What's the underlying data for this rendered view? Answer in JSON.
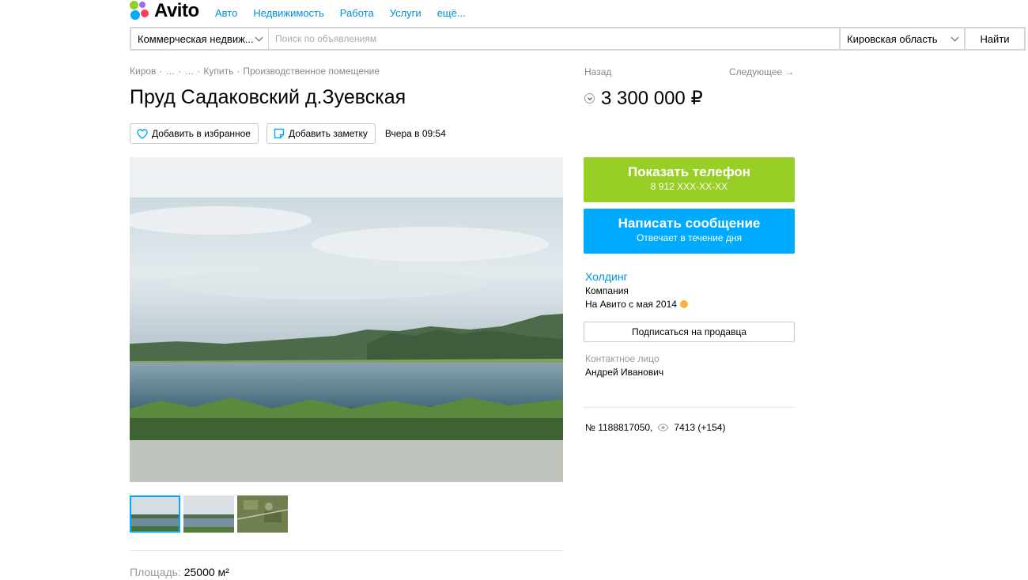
{
  "header": {
    "logo_text": "Avito",
    "nav": [
      "Авто",
      "Недвижимость",
      "Работа",
      "Услуги",
      "ещё..."
    ]
  },
  "search": {
    "category": "Коммерческая недвиж...",
    "placeholder": "Поиск по объявлениям",
    "region": "Кировская область",
    "button": "Найти"
  },
  "breadcrumb": [
    "Киров",
    "·",
    "…",
    "·",
    "…",
    "·",
    "Купить",
    "·",
    "Производственное помещение"
  ],
  "listing": {
    "title": "Пруд Садаковский д.Зуевская",
    "favorite_label": "Добавить в избранное",
    "note_label": "Добавить заметку",
    "date": "Вчера в 09:54",
    "param_label": "Площадь:",
    "param_value": "25000 м²"
  },
  "sidebar": {
    "back": "Назад",
    "next": "Следующее →",
    "price": "3 300 000 ₽",
    "phone_title": "Показать телефон",
    "phone_number": "8 912 XXX-XX-XX",
    "message_title": "Написать сообщение",
    "message_subtitle": "Отвечает в течение дня",
    "seller_name": "Холдинг",
    "seller_type": "Компания",
    "seller_since": "На Авито с мая 2014",
    "subscribe": "Подписаться на продавца",
    "contact_label": "Контактное лицо",
    "contact_name": "Андрей Иванович",
    "ad_number": "№ 1188817050,",
    "views": "7413 (+154)"
  },
  "colors": {
    "link": "#0091d9",
    "phone_button": "#97cf26",
    "message_button": "#00aaff",
    "thumb_active": "#00aaff"
  },
  "icons": [
    "heart-icon",
    "note-icon",
    "chevron-down-icon",
    "eye-icon",
    "medal-icon"
  ]
}
